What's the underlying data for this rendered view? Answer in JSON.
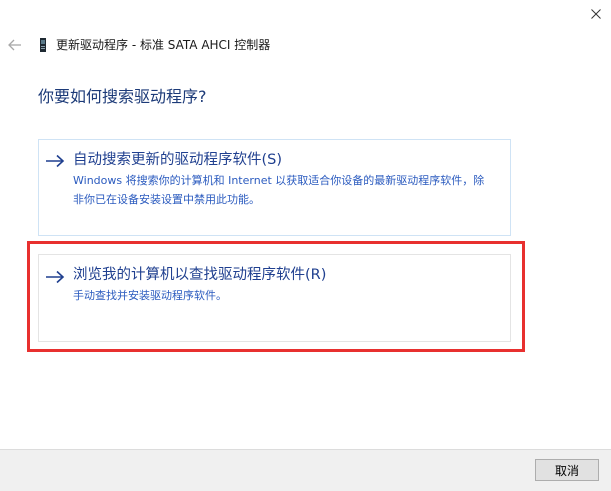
{
  "window": {
    "title": "更新驱动程序 - 标准 SATA AHCI 控制器"
  },
  "heading": "你要如何搜索驱动程序?",
  "options": [
    {
      "title": "自动搜索更新的驱动程序软件(S)",
      "description": "Windows 将搜索你的计算机和 Internet 以获取适合你设备的最新驱动程序软件，除非你已在设备安装设置中禁用此功能。"
    },
    {
      "title": "浏览我的计算机以查找驱动程序软件(R)",
      "description": "手动查找并安装驱动程序软件。"
    }
  ],
  "footer": {
    "cancel_label": "取消"
  },
  "colors": {
    "heading": "#1c3a78",
    "link": "#1f3f8f",
    "description": "#2b5bbf",
    "highlight": "#e8302f"
  },
  "icons": {
    "close": "close-icon",
    "back": "back-arrow-icon",
    "device": "device-icon",
    "option_arrow": "arrow-right-icon"
  }
}
